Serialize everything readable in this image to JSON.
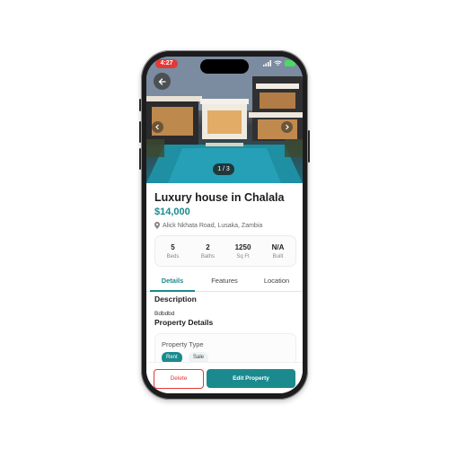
{
  "status_bar": {
    "time": "4:27"
  },
  "hero": {
    "image_counter": "1 / 3"
  },
  "listing": {
    "title": "Luxury house in Chalala",
    "price": "$14,000",
    "address": "Alick Nkhata Road, Lusaka, Zambia"
  },
  "stats": [
    {
      "value": "5",
      "label": "Beds"
    },
    {
      "value": "2",
      "label": "Baths"
    },
    {
      "value": "1250",
      "label": "Sq Ft"
    },
    {
      "value": "N/A",
      "label": "Built"
    }
  ],
  "tabs": [
    {
      "label": "Details",
      "active": true
    },
    {
      "label": "Features",
      "active": false
    },
    {
      "label": "Location",
      "active": false
    }
  ],
  "details": {
    "description_heading": "Description",
    "description_text": "Bdbdbd",
    "property_details_heading": "Property Details",
    "property_type_label": "Property Type",
    "chips": [
      {
        "label": "Rent",
        "selected": true
      },
      {
        "label": "Sale",
        "selected": false
      }
    ]
  },
  "footer": {
    "delete_label": "Delete",
    "edit_label": "Edit Property"
  },
  "colors": {
    "accent": "#1a8a8e",
    "danger": "#e53935"
  }
}
